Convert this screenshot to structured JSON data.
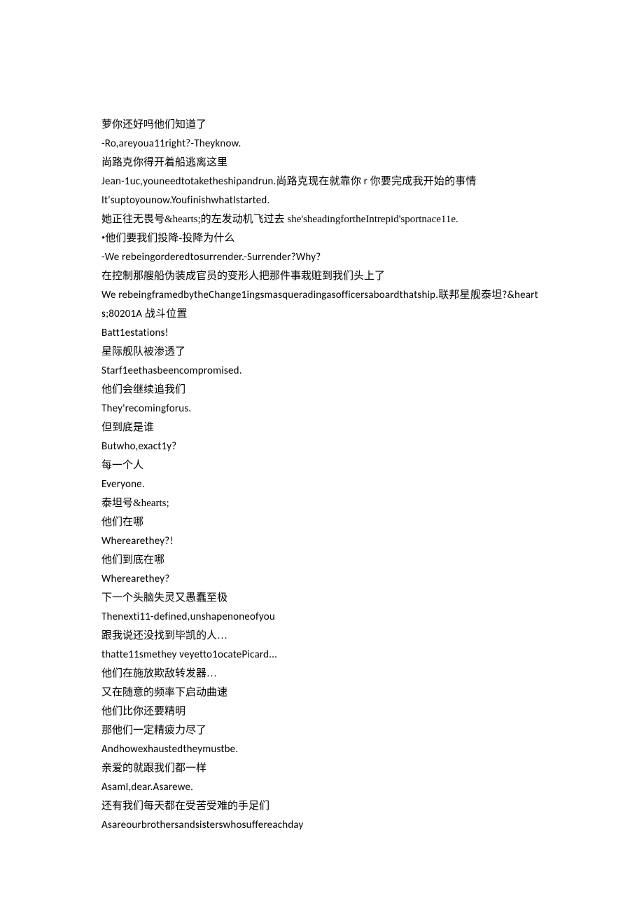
{
  "lines": [
    {
      "cls": "cn",
      "text": "萝你还好吗他们知道了"
    },
    {
      "cls": "en",
      "text": "-Ro,areyoua11right?-Theyknow."
    },
    {
      "cls": "cn",
      "text": "尚路克你得开着船逃离这里"
    },
    {
      "cls": "en",
      "text": "Jean-1uc,youneedtotaketheshipandrun.尚路克现在就靠你 r 你要完成我开始的事情"
    },
    {
      "cls": "en",
      "text": "It'suptoyounow.YoufinishwhatIstarted."
    },
    {
      "cls": "cn",
      "text": "她正往无畏号&hearts;的左发动机飞过去 she'sheadingfortheIntrepid'sportnace11e."
    },
    {
      "cls": "cn",
      "text": "•他们要我们投降-投降为什么"
    },
    {
      "cls": "en",
      "text": "-We rebeingorderedtosurrender.-Surrender?Why?"
    },
    {
      "cls": "cn",
      "text": "在控制那艘船伪装成官员的变形人把那件事栽赃到我们头上了"
    },
    {
      "cls": "en",
      "text": "We rebeingframedbytheChange1ingsmasqueradingasofficersaboardthatship.联邦星舰泰坦?&hearts;80201A 战斗位置"
    },
    {
      "cls": "en",
      "text": "Batt1estations!"
    },
    {
      "cls": "cn",
      "text": "星际舰队被渗透了"
    },
    {
      "cls": "en",
      "text": "Starf1eethasbeencompromised."
    },
    {
      "cls": "cn",
      "text": "他们会继续追我们"
    },
    {
      "cls": "en",
      "text": "They'recomingforus."
    },
    {
      "cls": "cn",
      "text": "但到底是谁"
    },
    {
      "cls": "en",
      "text": "Butwho,exact1y?"
    },
    {
      "cls": "cn",
      "text": "每一个人"
    },
    {
      "cls": "en",
      "text": "Everyone."
    },
    {
      "cls": "cn",
      "text": "泰坦号&hearts;"
    },
    {
      "cls": "cn",
      "text": "他们在哪"
    },
    {
      "cls": "en",
      "text": "Wherearethey?!"
    },
    {
      "cls": "cn",
      "text": "他们到底在哪"
    },
    {
      "cls": "en",
      "text": "Wherearethey?"
    },
    {
      "cls": "cn",
      "text": "下一个头脑失灵又愚蠢至极"
    },
    {
      "cls": "en",
      "text": "Thenexti11-defined,unshapenoneofyou"
    },
    {
      "cls": "cn",
      "text": "跟我说还没找到毕凯的人…"
    },
    {
      "cls": "en",
      "text": "thatte11smethey veyetto1ocatePicard..."
    },
    {
      "cls": "cn",
      "text": "他们在施放欺敌转发器…"
    },
    {
      "cls": "cn",
      "text": "又在随意的频率下启动曲速"
    },
    {
      "cls": "cn",
      "text": "他们比你还要精明"
    },
    {
      "cls": "cn",
      "text": "那他们一定精疲力尽了"
    },
    {
      "cls": "en",
      "text": "Andhowexhaustedtheymustbe."
    },
    {
      "cls": "cn",
      "text": "亲爱的就跟我们都一样"
    },
    {
      "cls": "en",
      "text": "AsamI,dear.Asarewe."
    },
    {
      "cls": "cn",
      "text": "还有我们每天都在受苦受难的手足们"
    },
    {
      "cls": "en",
      "text": "Asareourbrothersandsisterswhosuffereachday"
    }
  ]
}
